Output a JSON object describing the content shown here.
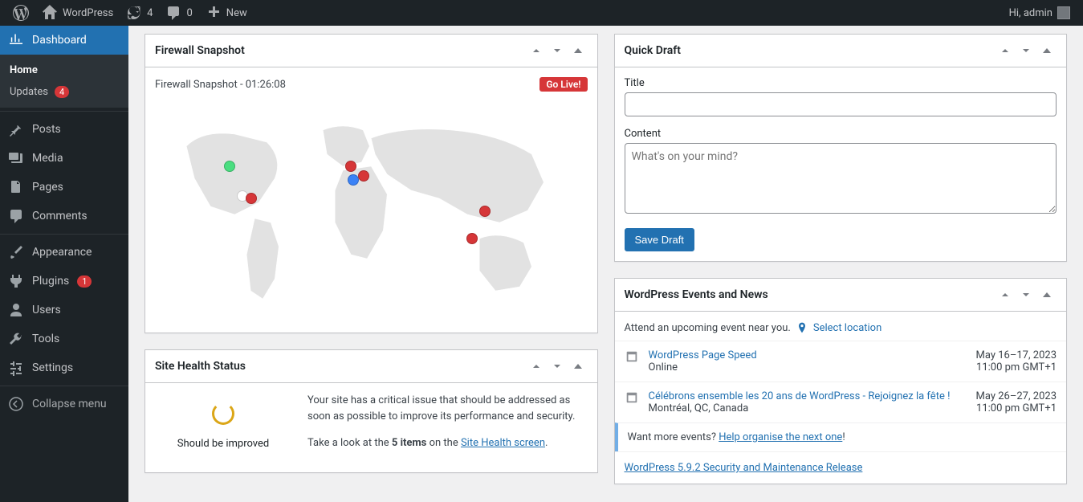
{
  "adminbar": {
    "site_name": "WordPress",
    "updates_count": "4",
    "comments_count": "0",
    "new_label": "New",
    "greeting": "Hi, admin"
  },
  "sidebar": {
    "dashboard": "Dashboard",
    "home": "Home",
    "updates": "Updates",
    "updates_badge": "4",
    "posts": "Posts",
    "media": "Media",
    "pages": "Pages",
    "comments": "Comments",
    "appearance": "Appearance",
    "plugins": "Plugins",
    "plugins_badge": "1",
    "users": "Users",
    "tools": "Tools",
    "settings": "Settings",
    "collapse": "Collapse menu"
  },
  "firewall": {
    "title": "Firewall Snapshot",
    "snapshot_label": "Firewall Snapshot - 01:26:08",
    "go_live": "Go Live!"
  },
  "site_health": {
    "title": "Site Health Status",
    "status": "Should be improved",
    "message": "Your site has a critical issue that should be addressed as soon as possible to improve its performance and security.",
    "link_prefix": "Take a look at the ",
    "link_bold": "5 items",
    "link_mid": " on the ",
    "link_text": "Site Health screen",
    "link_suffix": "."
  },
  "quick_draft": {
    "title": "Quick Draft",
    "title_label": "Title",
    "content_label": "Content",
    "content_placeholder": "What's on your mind?",
    "save_button": "Save Draft"
  },
  "events": {
    "title": "WordPress Events and News",
    "intro": "Attend an upcoming event near you.",
    "select_location": "Select location",
    "items": [
      {
        "title": "WordPress Page Speed",
        "location": "Online",
        "date": "May 16–17, 2023",
        "time": "11:00 pm GMT+1"
      },
      {
        "title": "Célébrons ensemble les 20 ans de WordPress - Rejoignez la fête !",
        "location": "Montréal, QC, Canada",
        "date": "May 26–27, 2023",
        "time": "11:00 pm GMT+1"
      }
    ],
    "footer_prefix": "Want more events? ",
    "footer_link": "Help organise the next one",
    "footer_suffix": "!",
    "news_link": "WordPress 5.9.2 Security and Maintenance Release"
  }
}
